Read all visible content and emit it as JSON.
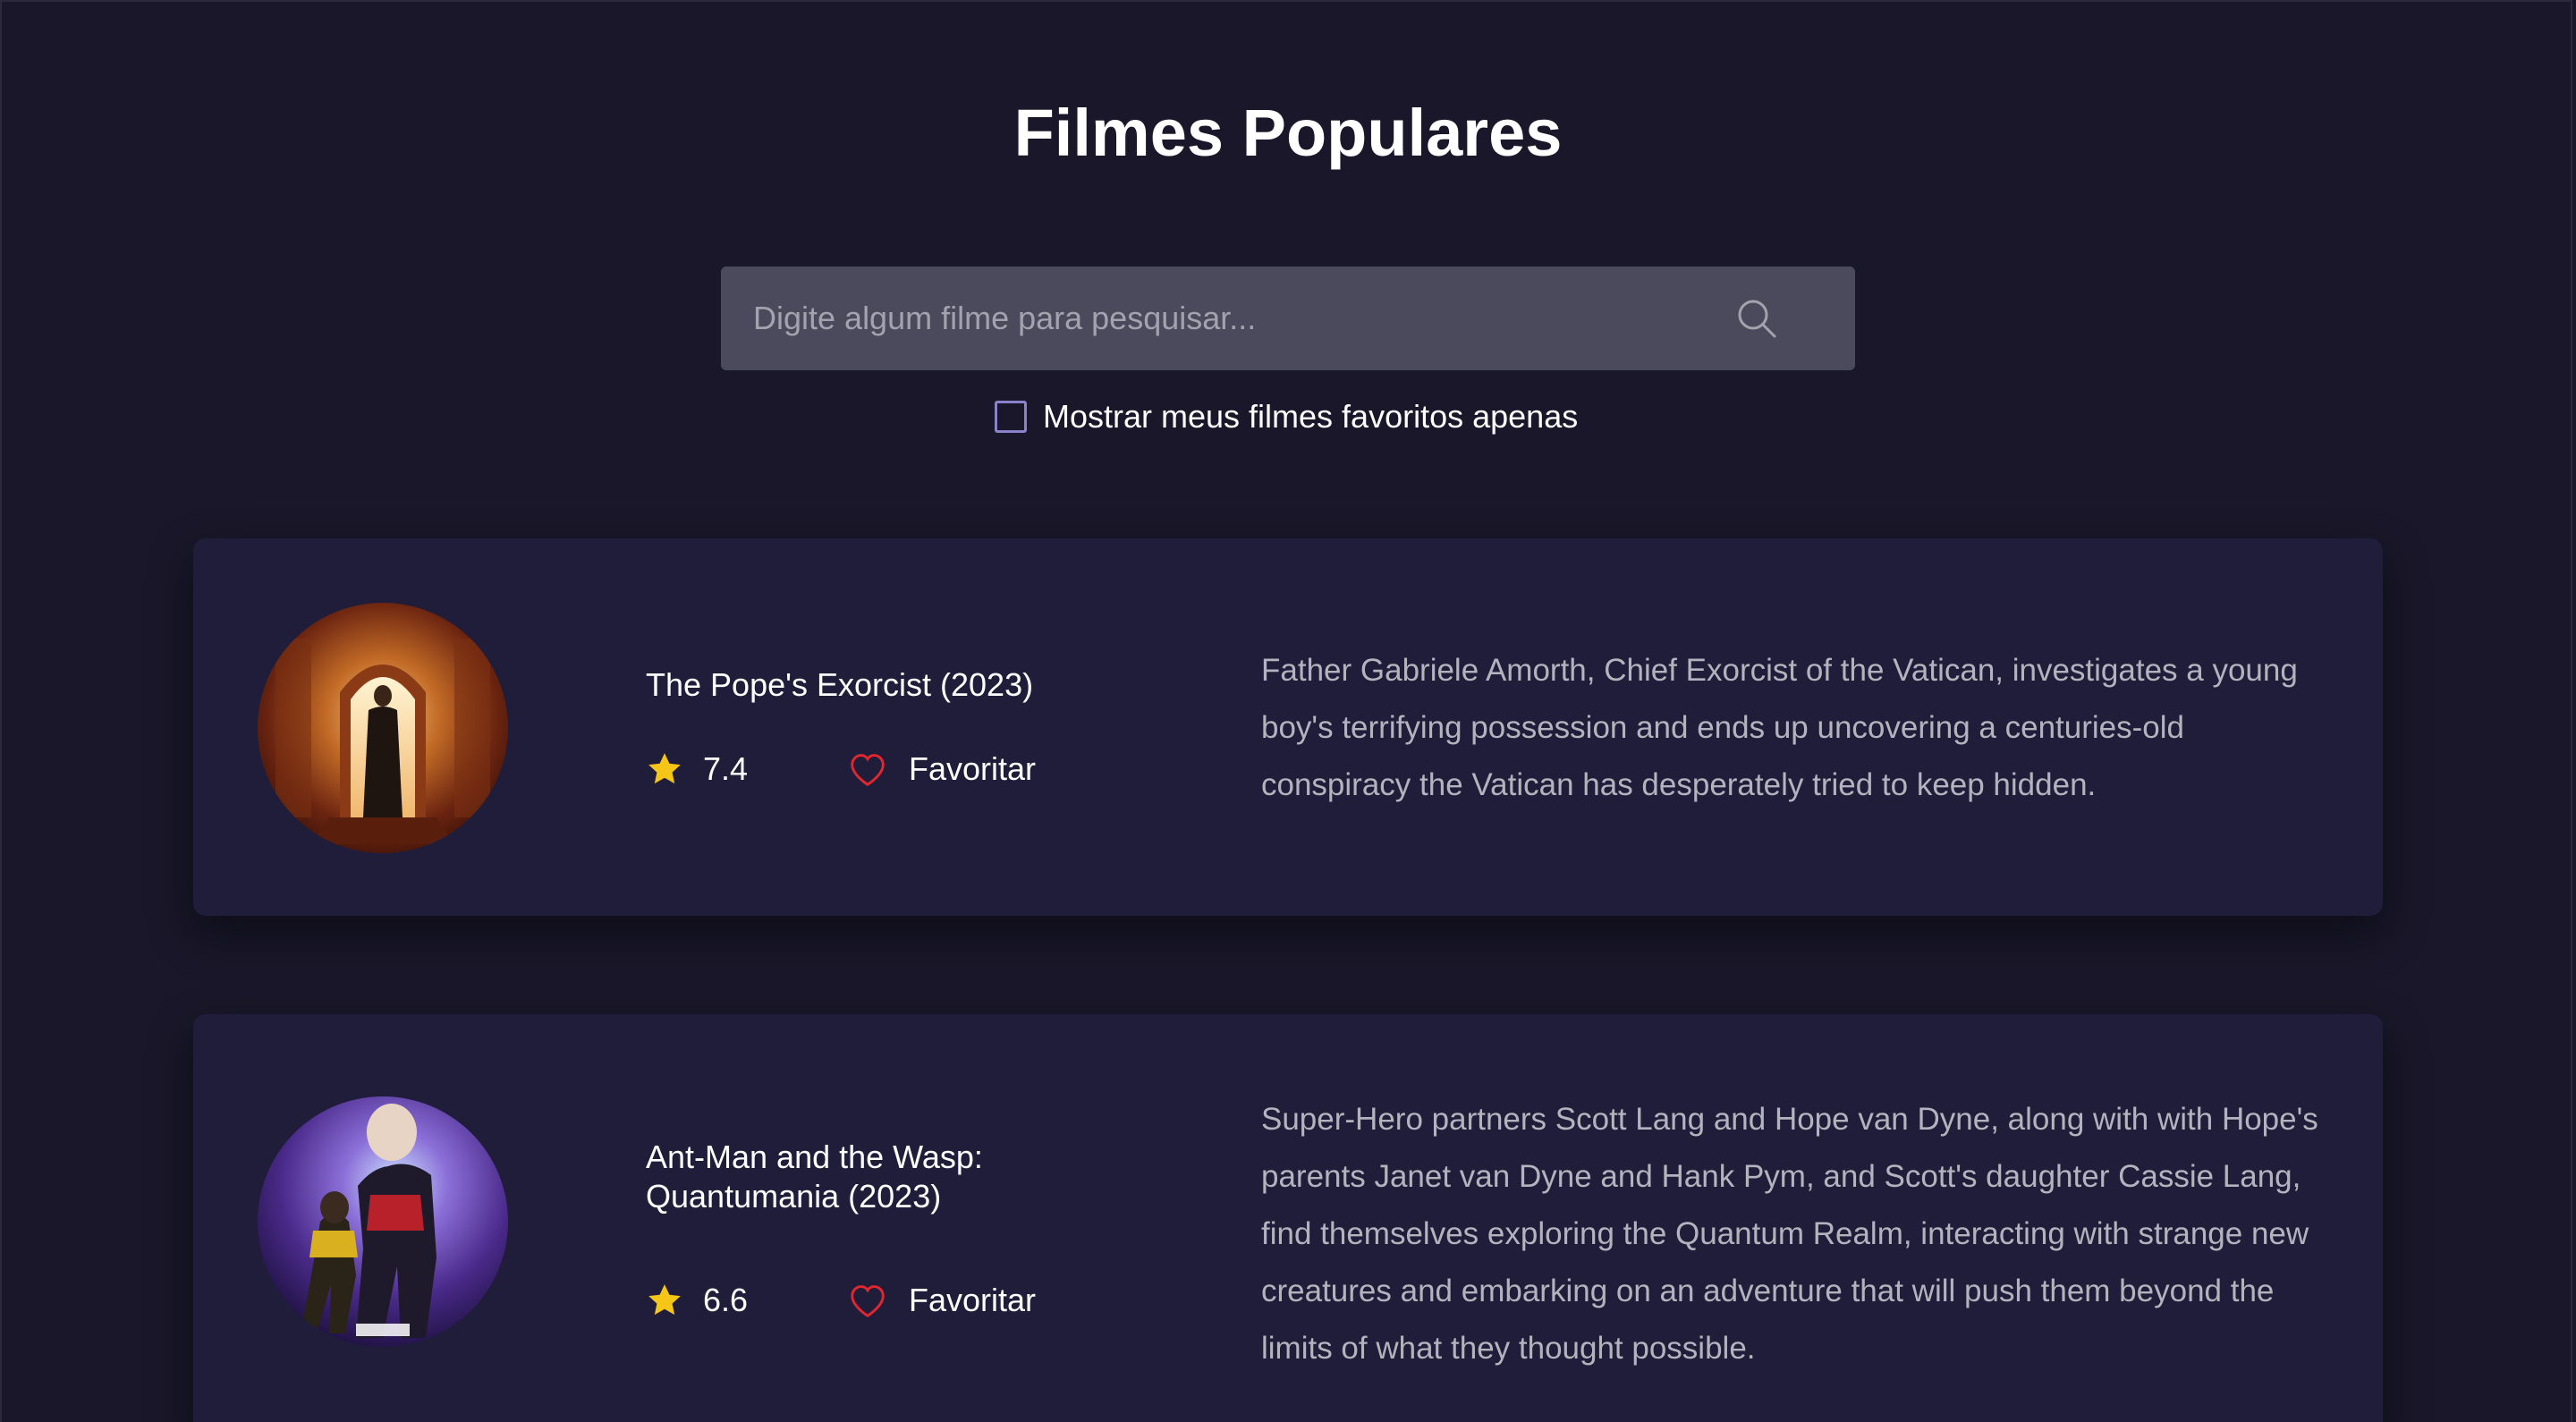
{
  "page": {
    "title": "Filmes Populares"
  },
  "search": {
    "placeholder": "Digite algum filme para pesquisar...",
    "value": "",
    "icon": "search-icon"
  },
  "filter": {
    "label": "Mostrar meus filmes favoritos apenas",
    "checked": false
  },
  "movies": [
    {
      "title": "The Pope's Exorcist (2023)",
      "rating": "7.4",
      "favorite_label": "Favoritar",
      "favorited": false,
      "overview": "Father Gabriele Amorth, Chief Exorcist of the Vatican, investigates a young boy's terrifying possession and ends up uncovering a centuries-old conspiracy the Vatican has desperately tried to keep hidden."
    },
    {
      "title": "Ant-Man and the Wasp: Quantumania (2023)",
      "rating": "6.6",
      "favorite_label": "Favoritar",
      "favorited": false,
      "overview": "Super-Hero partners Scott Lang and Hope van Dyne, along with with Hope's parents Janet van Dyne and Hank Pym, and Scott's daughter Cassie Lang, find themselves exploring the Quantum Realm, interacting with strange new creatures and embarking on an adventure that will push them beyond the limits of what they thought possible."
    }
  ],
  "colors": {
    "background": "#191729",
    "card": "#1f1d3a",
    "search_bg": "#4b4a5c",
    "checkbox_border": "#8a83c9",
    "star": "#f5c518",
    "heart": "#e0262f",
    "overview_text": "#b4b3bd"
  }
}
